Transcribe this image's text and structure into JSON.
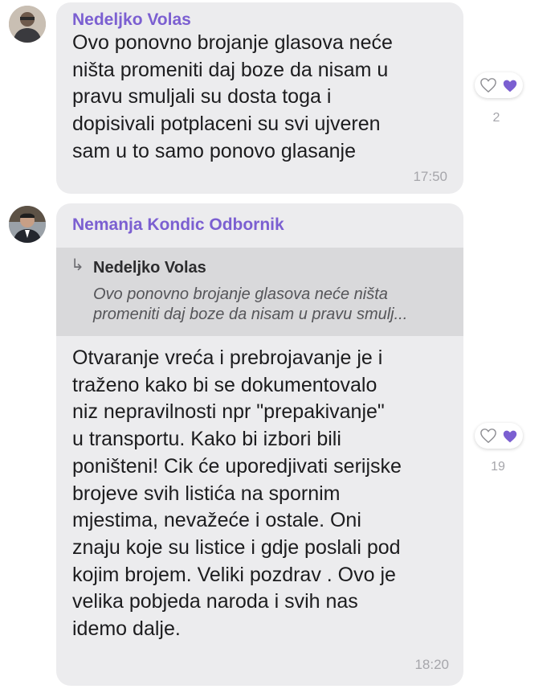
{
  "messages": [
    {
      "sender": "Nedeljko Volas",
      "lines": [
        "Ovo ponovno brojanje glasova neće",
        "ništa promeniti daj boze da nisam u",
        "pravu smuljali  su dosta toga i",
        "dopisivali potplaceni su svi ujveren",
        "sam u to samo ponovo glasanje"
      ],
      "time": "17:50",
      "reaction_count": "2"
    },
    {
      "sender": "Nemanja Kondic Odbornik",
      "reply": {
        "sender": "Nedeljko Volas",
        "arrow": "↳",
        "lines": [
          "Ovo ponovno brojanje glasova neće ništa",
          "promeniti daj boze da nisam u pravu smulj..."
        ]
      },
      "lines": [
        "Otvaranje vreća i prebrojavanje je i",
        "traženo kako bi se dokumentovalo",
        "niz nepravilnosti npr \"prepakivanje\"",
        "u transportu. Kako bi izbori bili",
        "poništeni! Cik će uporedjivati serijske",
        "brojeve svih listića na spornim",
        "mjestima, nevažeće i ostale. Oni",
        "znaju koje su listice i gdje poslali pod",
        "kojim brojem. Veliki pozdrav . Ovo je",
        "velika pobjeda naroda i svih nas",
        "idemo dalje."
      ],
      "time": "18:20",
      "reaction_count": "19"
    }
  ],
  "icons": {
    "like": "heart-outline-icon",
    "reacted": "heart-filled-icon",
    "reply": "reply-arrow-icon"
  },
  "colors": {
    "accent": "#7b5fd1",
    "bubble": "#ececee",
    "reply_bg": "#d9d9db",
    "heart_fill": "#7b5fd1"
  }
}
